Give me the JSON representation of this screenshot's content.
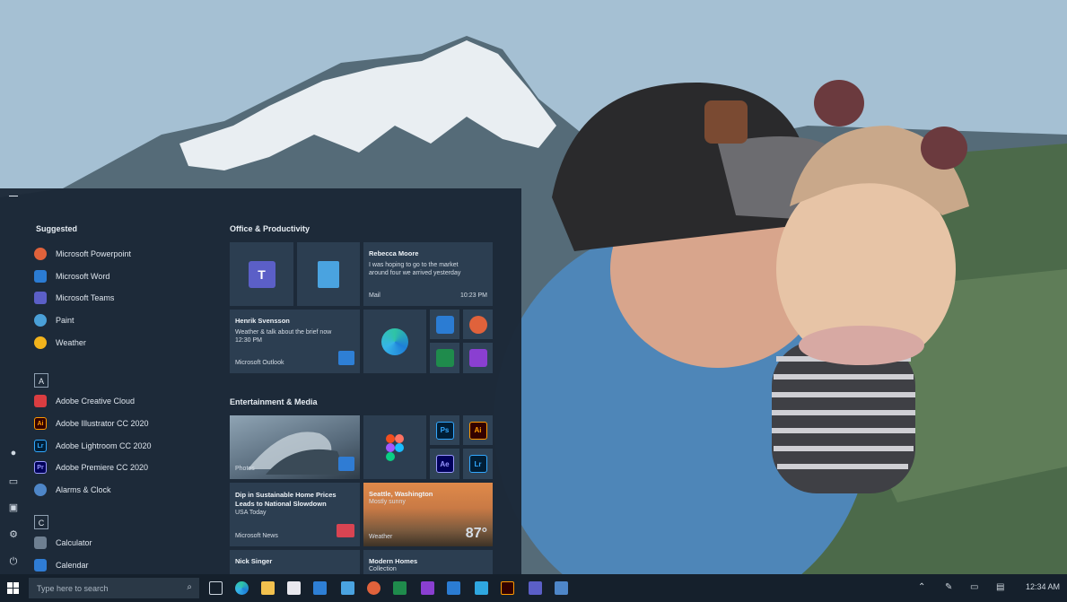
{
  "start_menu": {
    "suggested": {
      "title": "Suggested",
      "items": [
        {
          "label": "Microsoft Powerpoint",
          "icon": "powerpoint-icon",
          "color": "#e0623b"
        },
        {
          "label": "Microsoft Word",
          "icon": "word-icon",
          "color": "#2b7cd3"
        },
        {
          "label": "Microsoft Teams",
          "icon": "teams-icon",
          "color": "#5b5fc7"
        },
        {
          "label": "Paint",
          "icon": "paint-icon",
          "color": "#4aa0d8"
        },
        {
          "label": "Weather",
          "icon": "weather-icon",
          "color": "#f2b31c"
        }
      ]
    },
    "group_a": {
      "letter": "A",
      "items": [
        {
          "label": "Adobe Creative Cloud",
          "icon": "creative-cloud-icon",
          "color": "#da3d41"
        },
        {
          "label": "Adobe Illustrator CC 2020",
          "icon": "illustrator-icon",
          "color": "#ff9a00",
          "short": "Ai"
        },
        {
          "label": "Adobe Lightroom CC 2020",
          "icon": "lightroom-icon",
          "color": "#31a8ff",
          "short": "Lr"
        },
        {
          "label": "Adobe Premiere CC 2020",
          "icon": "premiere-icon",
          "color": "#9999ff",
          "short": "Pr"
        },
        {
          "label": "Alarms & Clock",
          "icon": "alarm-clock-icon",
          "color": "#4e86c8"
        }
      ]
    },
    "group_c": {
      "letter": "C",
      "items": [
        {
          "label": "Calculator",
          "icon": "calculator-icon",
          "color": "#6e7f91"
        },
        {
          "label": "Calendar",
          "icon": "calendar-icon",
          "color": "#2f7cd4"
        }
      ]
    },
    "office": {
      "title": "Office & Productivity",
      "mail": {
        "sender": "Rebecca Moore",
        "line1": "I was hoping to go to the market",
        "line2": "around four we arrived yesterday",
        "app": "Mail",
        "time": "10:23 PM"
      },
      "outlook": {
        "sender": "Henrik Svensson",
        "line1": "Weather & talk about the brief now",
        "line2": "12:30 PM",
        "app": "Microsoft Outlook"
      }
    },
    "entertainment": {
      "title": "Entertainment & Media",
      "photos_label": "Photos",
      "news": {
        "headline1": "Dip in Sustainable Home Prices",
        "headline2": "Leads to National Slowdown",
        "source": "USA Today",
        "app": "Microsoft News"
      },
      "weather": {
        "city": "Seattle, Washington",
        "cond": "Mostly sunny",
        "app": "Weather",
        "temp": "87°"
      },
      "movie": {
        "title": "Nick Singer"
      },
      "modern": {
        "title": "Modern Homes",
        "sub": "Collection"
      },
      "adobe": [
        {
          "short": "Ps",
          "icon": "photoshop-icon",
          "color": "#31a8ff"
        },
        {
          "short": "Ai",
          "icon": "illustrator-icon",
          "color": "#ff9a00"
        },
        {
          "short": "Ae",
          "icon": "after-effects-icon",
          "color": "#9999ff"
        },
        {
          "short": "Lr",
          "icon": "lightroom-icon",
          "color": "#31a8ff"
        }
      ]
    }
  },
  "taskbar": {
    "search_placeholder": "Type here to search",
    "time": "12:34 AM"
  }
}
